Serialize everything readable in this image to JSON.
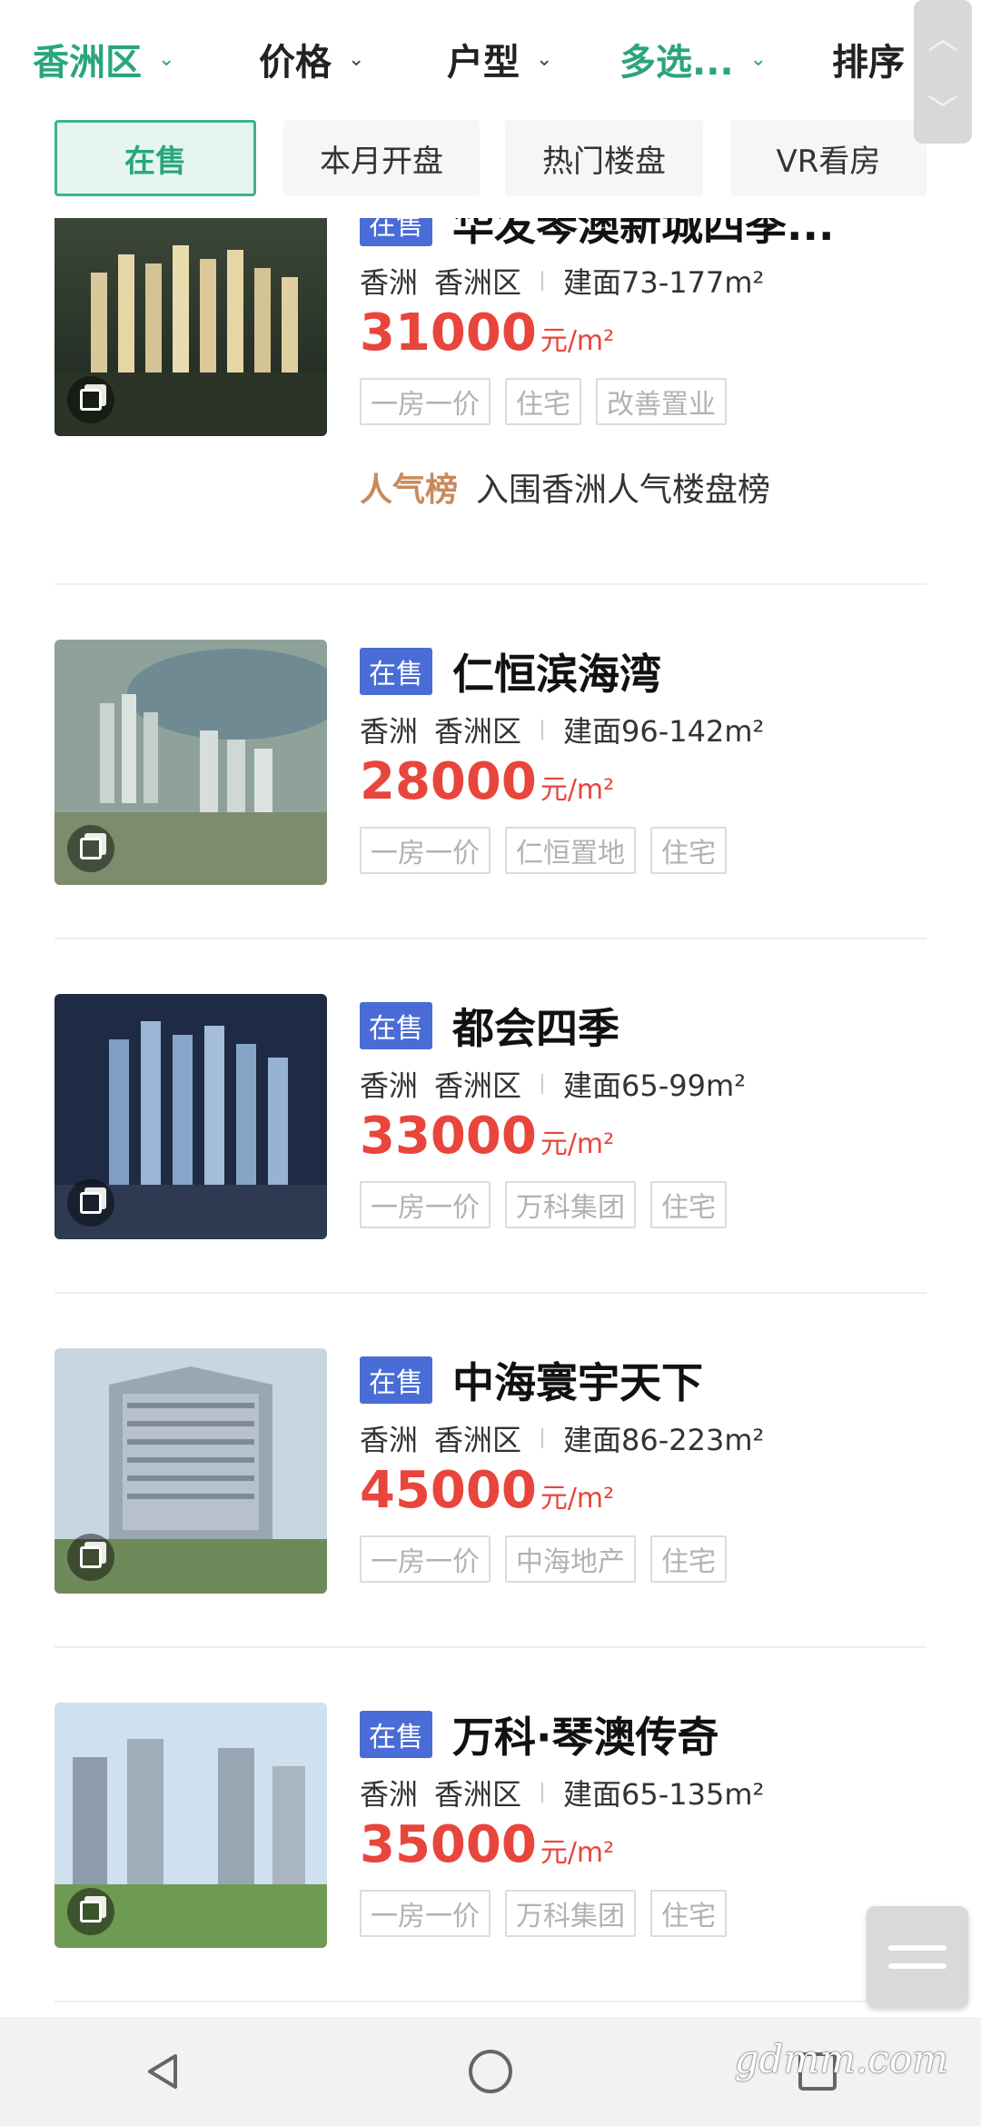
{
  "filters": [
    {
      "label": "香洲区",
      "active": true
    },
    {
      "label": "价格",
      "active": false
    },
    {
      "label": "户型",
      "active": false
    },
    {
      "label": "多选...",
      "active": true
    },
    {
      "label": "排序",
      "active": false
    }
  ],
  "tabs": [
    {
      "label": "在售",
      "active": true
    },
    {
      "label": "本月开盘",
      "active": false
    },
    {
      "label": "热门楼盘",
      "active": false
    },
    {
      "label": "VR看房",
      "active": false
    }
  ],
  "listings": [
    {
      "status": "在售",
      "name": "华发琴澳新城四季...",
      "city": "香洲",
      "district": "香洲区",
      "area": "建面73-177m²",
      "price": "31000",
      "unit": "元/m²",
      "tags": [
        "一房一价",
        "住宅",
        "改善置业"
      ],
      "ranking_label": "人气榜",
      "ranking_text": "入围香洲人气楼盘榜"
    },
    {
      "status": "在售",
      "name": "仁恒滨海湾",
      "city": "香洲",
      "district": "香洲区",
      "area": "建面96-142m²",
      "price": "28000",
      "unit": "元/m²",
      "tags": [
        "一房一价",
        "仁恒置地",
        "住宅"
      ]
    },
    {
      "status": "在售",
      "name": "都会四季",
      "city": "香洲",
      "district": "香洲区",
      "area": "建面65-99m²",
      "price": "33000",
      "unit": "元/m²",
      "tags": [
        "一房一价",
        "万科集团",
        "住宅"
      ]
    },
    {
      "status": "在售",
      "name": "中海寰宇天下",
      "city": "香洲",
      "district": "香洲区",
      "area": "建面86-223m²",
      "price": "45000",
      "unit": "元/m²",
      "tags": [
        "一房一价",
        "中海地产",
        "住宅"
      ]
    },
    {
      "status": "在售",
      "name": "万科·琴澳传奇",
      "city": "香洲",
      "district": "香洲区",
      "area": "建面65-135m²",
      "price": "35000",
      "unit": "元/m²",
      "tags": [
        "一房一价",
        "万科集团",
        "住宅"
      ]
    }
  ],
  "watermark": "gdmm.com",
  "colors": {
    "accent_green": "#2aa67a",
    "price_red": "#e8453c",
    "status_blue": "#4a6cd6",
    "ranking_gold": "#c98a5b"
  },
  "icons": {
    "chevron": "chevron-down-icon",
    "sort": "sort-icon",
    "thumb_badge": "gallery-icon",
    "menu": "menu-icon"
  }
}
